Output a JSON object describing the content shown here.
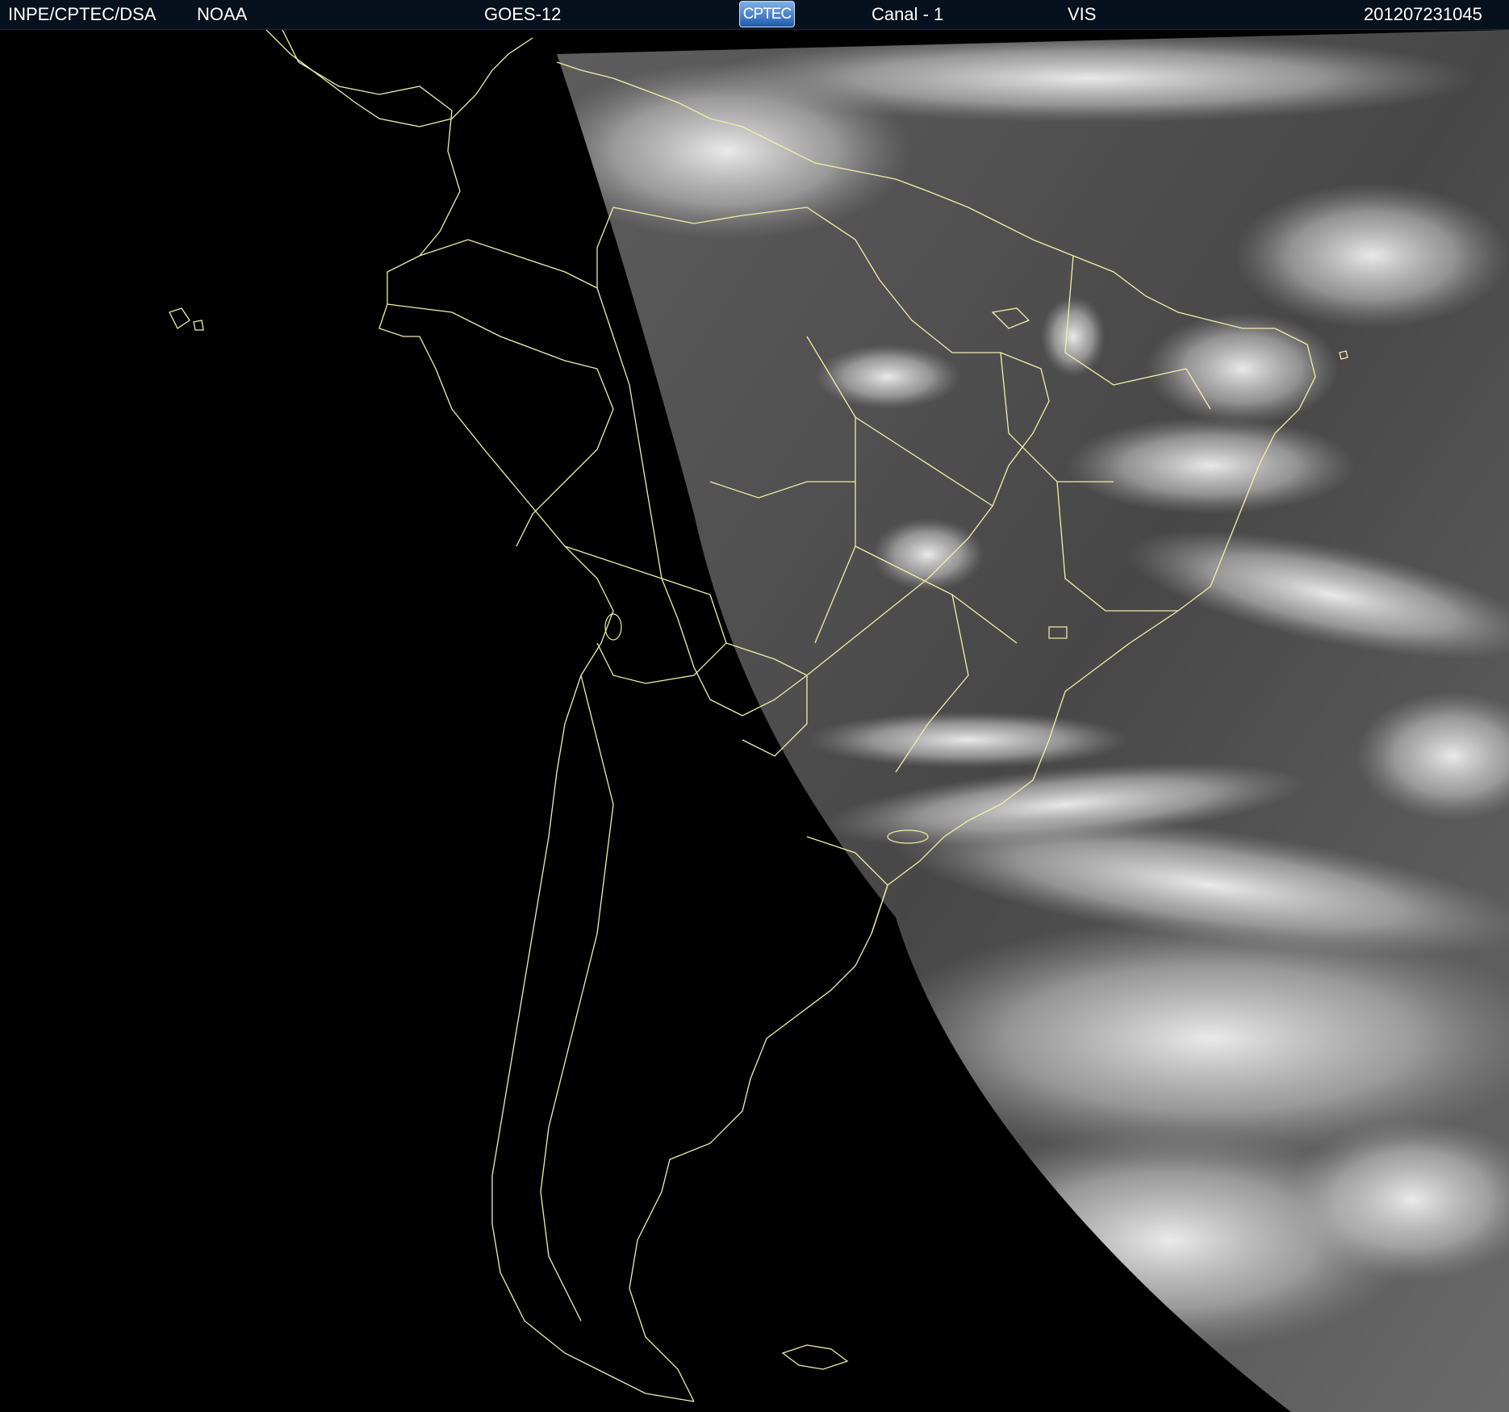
{
  "header": {
    "agency": "INPE/CPTEC/DSA",
    "provider": "NOAA",
    "satellite": "GOES-12",
    "logo_text": "CPTEC",
    "channel": "Canal - 1",
    "band": "VIS",
    "timestamp": "201207231045"
  },
  "map": {
    "region": "South America",
    "imagery_type": "visible satellite image",
    "illuminated_side": "east",
    "dark_side": "west",
    "outline_color": "#f1f0a4",
    "background_color": "#000000",
    "cloud_color": "#e8e8e8",
    "surface_color": "#4a4a4a"
  }
}
